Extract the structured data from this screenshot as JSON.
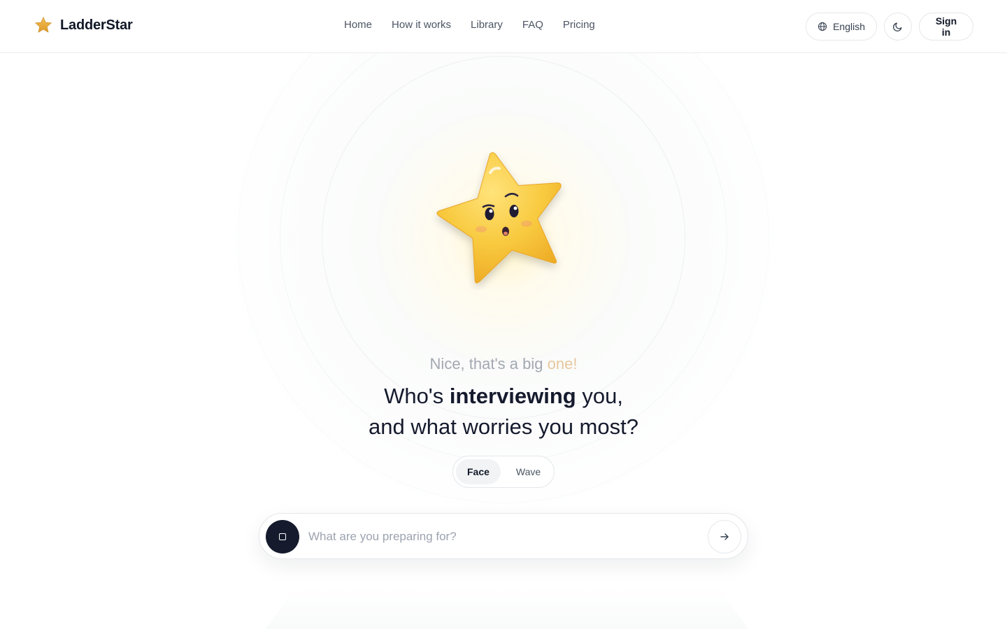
{
  "brand": {
    "name": "LadderStar",
    "accent_color": "#E8A93A",
    "logo_icon": "star-icon"
  },
  "nav": {
    "items": [
      {
        "label": "Home"
      },
      {
        "label": "How it works"
      },
      {
        "label": "Library"
      },
      {
        "label": "FAQ"
      },
      {
        "label": "Pricing"
      }
    ]
  },
  "header_actions": {
    "language_label": "English",
    "language_icon": "globe-icon",
    "theme_icon": "moon-icon",
    "signin_label": "Sign in"
  },
  "hero": {
    "mascot": "star-mascot",
    "eyebrow_lead": "Nice, that's a big ",
    "eyebrow_accent": "one!",
    "eyebrow_accent_color": "#E7C79D",
    "headline_part1": "Who's ",
    "headline_bold": "interviewing",
    "headline_part2": " you,",
    "headline_line2": "and what worries you most?",
    "headline_color": "#151A2D"
  },
  "mode_toggle": {
    "options": [
      {
        "label": "Face",
        "active": true
      },
      {
        "label": "Wave",
        "active": false
      }
    ]
  },
  "prompt": {
    "placeholder": "What are you preparing for?",
    "value": "",
    "record_icon": "stop-icon",
    "send_icon": "arrow-right-icon"
  }
}
